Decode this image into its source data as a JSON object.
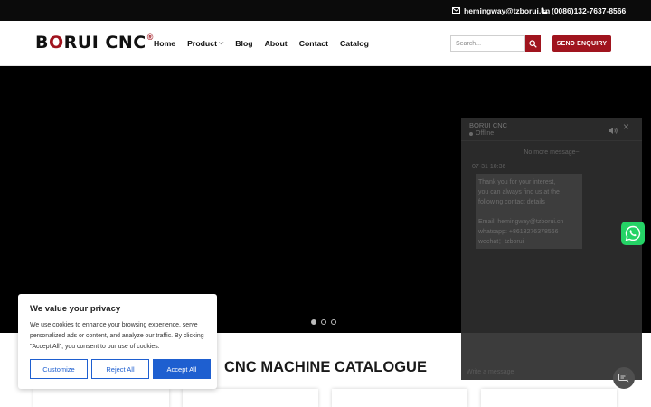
{
  "topbar": {
    "email": "hemingway@tzborui.cn",
    "phone": "(0086)132-7637-8566"
  },
  "header": {
    "logo_text": "B",
    "logo_o": "O",
    "logo_rest": "RUI CNC",
    "logo_reg": "®",
    "nav": [
      {
        "label": "Home"
      },
      {
        "label": "Product",
        "dropdown": true
      },
      {
        "label": "Blog"
      },
      {
        "label": "About"
      },
      {
        "label": "Contact"
      },
      {
        "label": "Catalog"
      }
    ],
    "search_placeholder": "Search...",
    "enquiry_label": "SEND ENQUIRY"
  },
  "slider": {
    "slides": 3,
    "active": 1
  },
  "section": {
    "title": "CNC MACHINE CATALOGUE"
  },
  "chat": {
    "title": "BORUI CNC",
    "status": "Offline",
    "no_more": "No more message~",
    "time": "07-31 10:36",
    "message": "Thank you for your interest,\nyou can always find us at the\nfollowing contact details\n\nEmail: hemingway@tzborui.cn\nwhatsapp: +8613276378566\nwechat：tzborui",
    "input_placeholder": "Write a message"
  },
  "cookie": {
    "title": "We value your privacy",
    "text": "We use cookies to enhance your browsing experience, serve personalized ads or content, and analyze our traffic. By clicking \"Accept All\", you consent to our use of cookies.",
    "customize": "Customize",
    "reject": "Reject All",
    "accept": "Accept All"
  },
  "colors": {
    "brand": "#a0141e",
    "cookie_blue": "#1e5fd0",
    "whatsapp": "#25d366"
  }
}
